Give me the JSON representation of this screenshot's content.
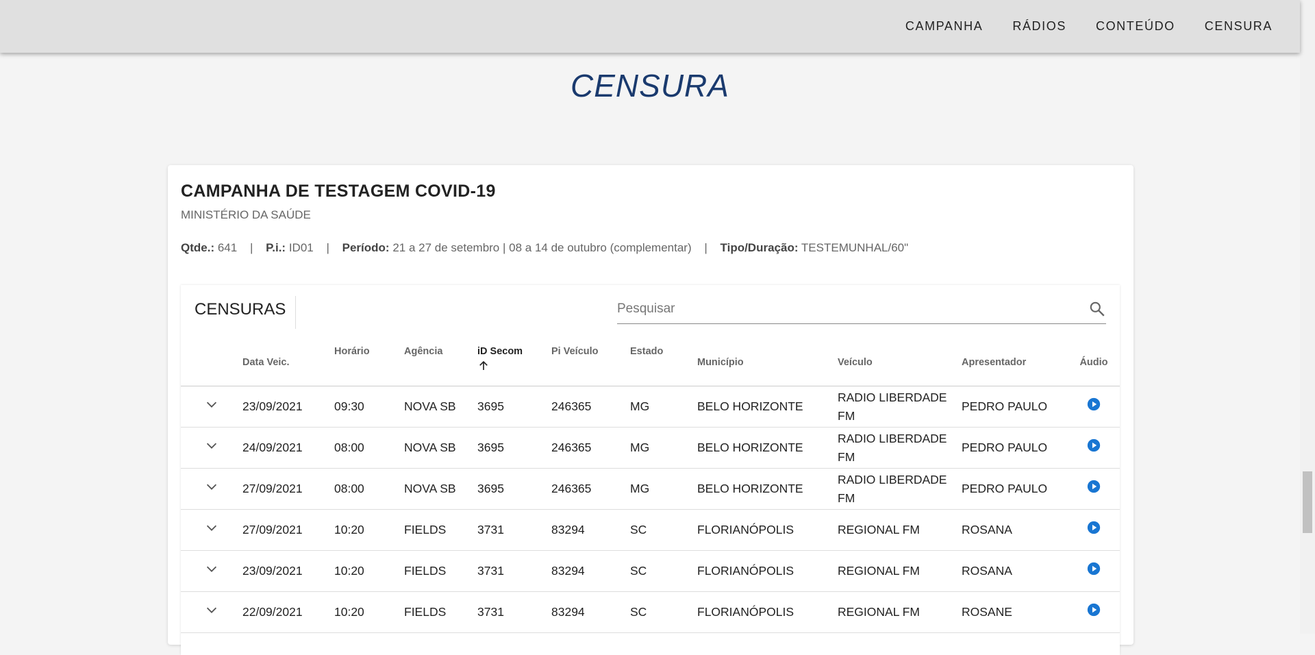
{
  "nav": {
    "items": [
      "CAMPANHA",
      "RÁDIOS",
      "CONTEÚDO",
      "CENSURA"
    ]
  },
  "page": {
    "title": "CENSURA"
  },
  "campaign": {
    "title": "CAMPANHA DE TESTAGEM COVID-19",
    "subtitle": "MINISTÉRIO DA SAÚDE",
    "meta": {
      "qtde_label": "Qtde.:",
      "qtde_value": "641",
      "pi_label": "P.i.:",
      "pi_value": "ID01",
      "periodo_label": "Período:",
      "periodo_value": "21 a 27 de setembro | 08 a 14 de outubro (complementar)",
      "tipo_label": "Tipo/Duração:",
      "tipo_value": "TESTEMUNHAL/60\"",
      "separator": "|"
    }
  },
  "panel": {
    "title": "CENSURAS",
    "search_placeholder": "Pesquisar"
  },
  "table": {
    "headers": [
      "Data Veic.",
      "Horário",
      "Agência",
      "iD Secom",
      "Pi Veículo",
      "Estado",
      "Município",
      "Veículo",
      "Apresentador",
      "Áudio"
    ],
    "sorted_column": "iD Secom",
    "rows": [
      {
        "data": "23/09/2021",
        "horario": "09:30",
        "agencia": "NOVA SB",
        "idsecom": "3695",
        "piveiculo": "246365",
        "estado": "MG",
        "municipio": "BELO HORIZONTE",
        "veiculo": "RADIO LIBERDADE FM",
        "apresentador": "PEDRO PAULO"
      },
      {
        "data": "24/09/2021",
        "horario": "08:00",
        "agencia": "NOVA SB",
        "idsecom": "3695",
        "piveiculo": "246365",
        "estado": "MG",
        "municipio": "BELO HORIZONTE",
        "veiculo": "RADIO LIBERDADE FM",
        "apresentador": "PEDRO PAULO"
      },
      {
        "data": "27/09/2021",
        "horario": "08:00",
        "agencia": "NOVA SB",
        "idsecom": "3695",
        "piveiculo": "246365",
        "estado": "MG",
        "municipio": "BELO HORIZONTE",
        "veiculo": "RADIO LIBERDADE FM",
        "apresentador": "PEDRO PAULO"
      },
      {
        "data": "27/09/2021",
        "horario": "10:20",
        "agencia": "FIELDS",
        "idsecom": "3731",
        "piveiculo": "83294",
        "estado": "SC",
        "municipio": "FLORIANÓPOLIS",
        "veiculo": "REGIONAL FM",
        "apresentador": "ROSANA"
      },
      {
        "data": "23/09/2021",
        "horario": "10:20",
        "agencia": "FIELDS",
        "idsecom": "3731",
        "piveiculo": "83294",
        "estado": "SC",
        "municipio": "FLORIANÓPOLIS",
        "veiculo": "REGIONAL FM",
        "apresentador": "ROSANA"
      },
      {
        "data": "22/09/2021",
        "horario": "10:20",
        "agencia": "FIELDS",
        "idsecom": "3731",
        "piveiculo": "83294",
        "estado": "SC",
        "municipio": "FLORIANÓPOLIS",
        "veiculo": "REGIONAL FM",
        "apresentador": "ROSANE"
      }
    ]
  },
  "icons": {
    "search": "search-icon",
    "expand": "chevron-down-icon",
    "play": "play-circle-icon",
    "sort": "arrow-up-icon"
  },
  "colors": {
    "title": "#1a3a6e",
    "play": "#1976d2",
    "header_bg": "#e0e0e0"
  }
}
